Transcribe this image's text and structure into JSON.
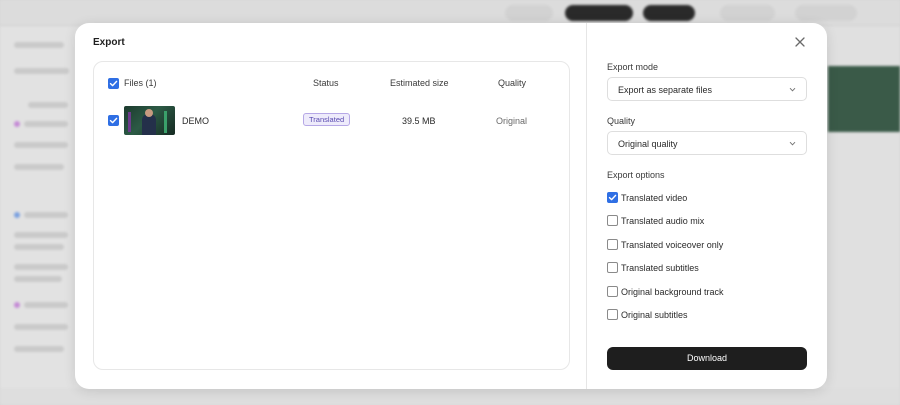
{
  "modal": {
    "title": "Export",
    "close_icon": "close-icon"
  },
  "files_table": {
    "select_all_checked": true,
    "headers": {
      "files": "Files (1)",
      "status": "Status",
      "estimated_size": "Estimated size",
      "quality": "Quality"
    },
    "rows": [
      {
        "checked": true,
        "name": "DEMO",
        "status": "Translated",
        "size": "39.5 MB",
        "quality": "Original"
      }
    ]
  },
  "settings": {
    "export_mode_label": "Export mode",
    "export_mode_value": "Export as separate files",
    "quality_label": "Quality",
    "quality_value": "Original quality",
    "export_options_label": "Export options",
    "options": [
      {
        "label": "Translated video",
        "checked": true
      },
      {
        "label": "Translated audio mix",
        "checked": false
      },
      {
        "label": "Translated voiceover only",
        "checked": false
      },
      {
        "label": "Translated subtitles",
        "checked": false
      },
      {
        "label": "Original background track",
        "checked": false
      },
      {
        "label": "Original subtitles",
        "checked": false
      }
    ],
    "download_label": "Download"
  },
  "colors": {
    "accent": "#2f6fe4",
    "badge_bg": "#eeebfb",
    "badge_border": "#b6a8e6",
    "badge_text": "#5a4bb0",
    "primary_button": "#1e1e1e"
  }
}
